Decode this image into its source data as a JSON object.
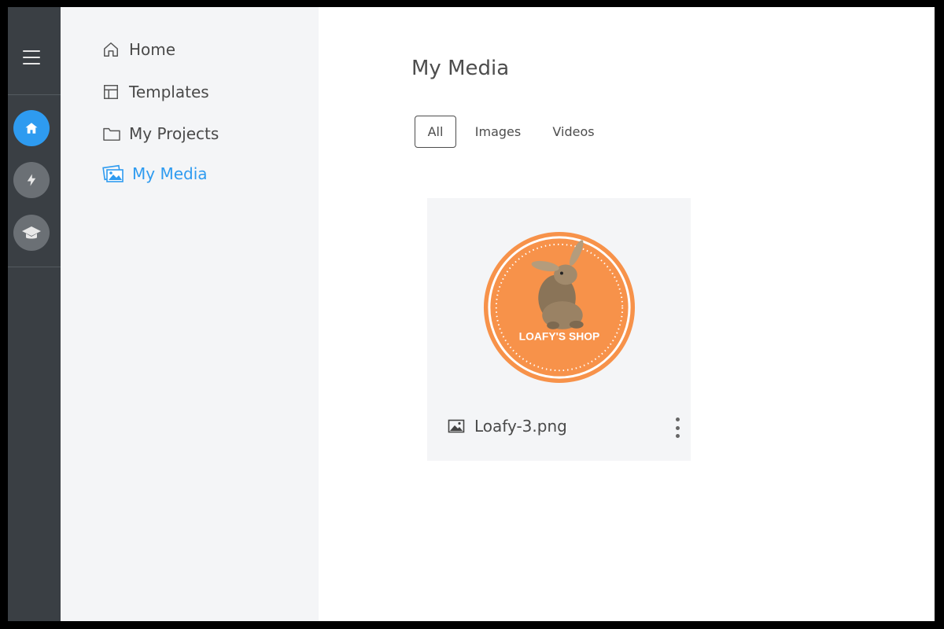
{
  "nav": {
    "items": [
      {
        "label": "Home",
        "icon": "home-icon"
      },
      {
        "label": "Templates",
        "icon": "templates-icon"
      },
      {
        "label": "My Projects",
        "icon": "folder-icon"
      },
      {
        "label": "My Media",
        "icon": "media-icon",
        "active": true
      }
    ]
  },
  "rail": {
    "buttons": [
      "home-icon",
      "lightning-icon",
      "graduation-cap-icon"
    ]
  },
  "main": {
    "title": "My Media",
    "tabs": [
      {
        "label": "All",
        "selected": true
      },
      {
        "label": "Images"
      },
      {
        "label": "Videos"
      }
    ],
    "media": [
      {
        "file_name": "Loafy-3.png",
        "file_type_icon": "image-icon",
        "thumbnail_text": "LOAFY'S SHOP"
      }
    ]
  },
  "colors": {
    "accent": "#2e9bf0",
    "rail_bg": "#3a3f44",
    "nav_bg": "#f4f5f7",
    "logo_orange": "#f7924a"
  }
}
